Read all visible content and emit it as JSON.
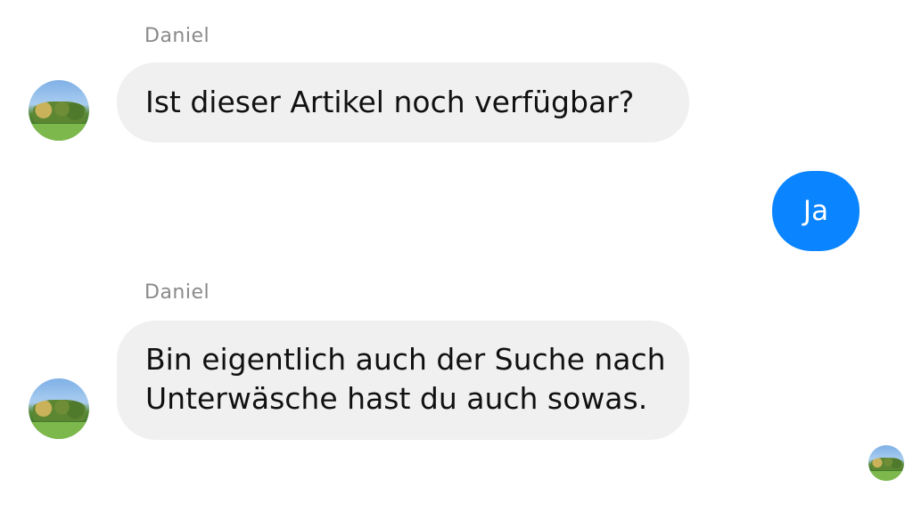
{
  "messages": [
    {
      "sender": "Daniel",
      "direction": "incoming",
      "text": "Ist dieser Artikel noch verfügbar?"
    },
    {
      "direction": "outgoing",
      "text": "Ja"
    },
    {
      "sender": "Daniel",
      "direction": "incoming",
      "line1": "Bin eigentlich auch der Suche nach",
      "line2": "Unterwäsche hast du auch sowas."
    }
  ],
  "colors": {
    "incoming_bubble": "#f0f0f0",
    "outgoing_bubble": "#0a84ff",
    "sender_name": "#8a8a8a"
  },
  "icons": {
    "sender_avatar": "avatar-landscape-photo",
    "read_receipt": "avatar-landscape-photo"
  }
}
